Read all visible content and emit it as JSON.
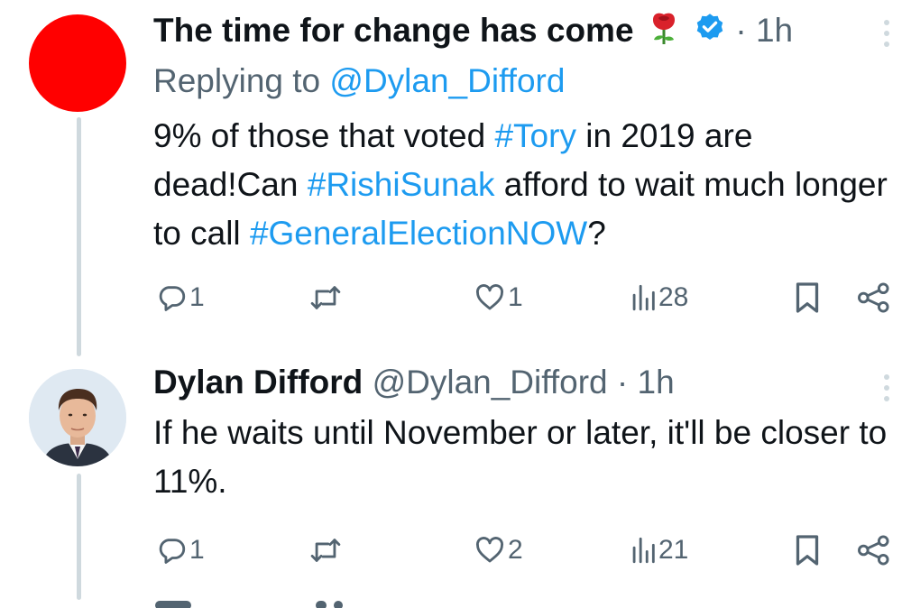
{
  "tweets": [
    {
      "display_name": "The time for change has come",
      "time": "· 1h",
      "replying_label": "Replying to",
      "replying_handle": "@Dylan_Difford",
      "body": [
        {
          "text": "9% of those that voted ",
          "link": false
        },
        {
          "text": "#Tory",
          "link": true
        },
        {
          "text": " in 2019 are dead!Can ",
          "link": false
        },
        {
          "text": "#RishiSunak",
          "link": true
        },
        {
          "text": " afford to wait much longer to call ",
          "link": false
        },
        {
          "text": "#GeneralElectionNOW",
          "link": true
        },
        {
          "text": "?",
          "link": false
        }
      ],
      "counts": {
        "replies": "1",
        "retweets": "",
        "likes": "1",
        "views": "28"
      }
    },
    {
      "display_name": "Dylan Difford",
      "handle": "@Dylan_Difford",
      "time": "· 1h",
      "body": [
        {
          "text": "If he waits until November or later, it'll be closer to 11%.",
          "link": false
        }
      ],
      "counts": {
        "replies": "1",
        "retweets": "",
        "likes": "2",
        "views": "21"
      }
    }
  ],
  "icons": [
    "reply-icon",
    "retweet-icon",
    "like-icon",
    "views-icon",
    "bookmark-icon",
    "share-icon",
    "verified-badge-icon",
    "rose-icon",
    "more-icon"
  ],
  "colors": {
    "link": "#1d9bf0",
    "muted": "#536471",
    "text": "#0f1419",
    "avatar_red": "#ff0000",
    "thread_line": "#cfd9de"
  }
}
